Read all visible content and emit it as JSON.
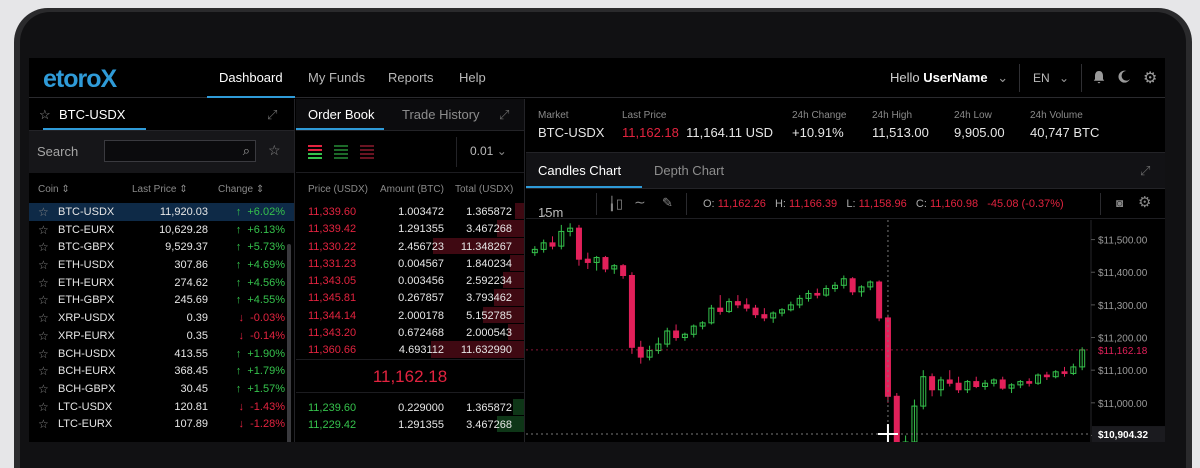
{
  "brand": {
    "name": "etoro",
    "mark": "X"
  },
  "nav": {
    "items": [
      "Dashboard",
      "My Funds",
      "Reports",
      "Help"
    ],
    "active": "Dashboard",
    "hello": "Hello",
    "username": "UserName",
    "language": "EN"
  },
  "market": {
    "tab_label": "BTC-USDX",
    "search_label": "Search",
    "search_value": "",
    "columns": {
      "coin": "Coin",
      "last_price": "Last Price",
      "change": "Change"
    },
    "rows": [
      {
        "coin": "BTC-USDX",
        "price": "11,920.03",
        "change": "+6.02%",
        "dir": "up",
        "selected": true
      },
      {
        "coin": "BTC-EURX",
        "price": "10,629.28",
        "change": "+6.13%",
        "dir": "up"
      },
      {
        "coin": "BTC-GBPX",
        "price": "9,529.37",
        "change": "+5.73%",
        "dir": "up"
      },
      {
        "coin": "ETH-USDX",
        "price": "307.86",
        "change": "+4.69%",
        "dir": "up"
      },
      {
        "coin": "ETH-EURX",
        "price": "274.62",
        "change": "+4.56%",
        "dir": "up"
      },
      {
        "coin": "ETH-GBPX",
        "price": "245.69",
        "change": "+4.55%",
        "dir": "up"
      },
      {
        "coin": "XRP-USDX",
        "price": "0.39",
        "change": "-0.03%",
        "dir": "down"
      },
      {
        "coin": "XRP-EURX",
        "price": "0.35",
        "change": "-0.14%",
        "dir": "down"
      },
      {
        "coin": "BCH-USDX",
        "price": "413.55",
        "change": "+1.90%",
        "dir": "up"
      },
      {
        "coin": "BCH-EURX",
        "price": "368.45",
        "change": "+1.79%",
        "dir": "up"
      },
      {
        "coin": "BCH-GBPX",
        "price": "30.45",
        "change": "+1.57%",
        "dir": "up"
      },
      {
        "coin": "LTC-USDX",
        "price": "120.81",
        "change": "-1.43%",
        "dir": "down"
      },
      {
        "coin": "LTC-EURX",
        "price": "107.89",
        "change": "-1.28%",
        "dir": "down"
      }
    ]
  },
  "orderbook": {
    "tabs": [
      "Order Book",
      "Trade History"
    ],
    "precision": "0.01",
    "columns": {
      "price": "Price (USDX)",
      "amount": "Amount (BTC)",
      "total": "Total (USDX)"
    },
    "asks": [
      {
        "price": "11,339.60",
        "amount": "1.003472",
        "total": "1.365872",
        "depth": 0.04
      },
      {
        "price": "11,339.42",
        "amount": "1.291355",
        "total": "3.467268",
        "depth": 0.12
      },
      {
        "price": "11,330.22",
        "amount": "2.456723",
        "total": "11.348267",
        "depth": 0.4
      },
      {
        "price": "11,331.23",
        "amount": "0.004567",
        "total": "1.840234",
        "depth": 0.06
      },
      {
        "price": "11,343.05",
        "amount": "0.003456",
        "total": "2.592234",
        "depth": 0.09
      },
      {
        "price": "11,345.81",
        "amount": "0.267857",
        "total": "3.793462",
        "depth": 0.13
      },
      {
        "price": "11,344.14",
        "amount": "2.000178",
        "total": "5.152785",
        "depth": 0.18
      },
      {
        "price": "11,343.20",
        "amount": "0.672468",
        "total": "2.000543",
        "depth": 0.07
      },
      {
        "price": "11,360.66",
        "amount": "4.693112",
        "total": "11.632990",
        "depth": 0.41
      }
    ],
    "spread": "11,162.18",
    "bids": [
      {
        "price": "11,239.60",
        "amount": "0.229000",
        "total": "1.365872",
        "depth": 0.05
      },
      {
        "price": "11,229.42",
        "amount": "1.291355",
        "total": "3.467268",
        "depth": 0.12
      }
    ]
  },
  "ticker": {
    "market_label": "Market",
    "market": "BTC-USDX",
    "last_price_label": "Last Price",
    "last_price_a": "11,162.18",
    "last_price_b": "11,164.11 USD",
    "change_label": "24h Change",
    "change": "+10.91%",
    "high_label": "24h High",
    "high": "11,513.00",
    "low_label": "24h Low",
    "low": "9,905.00",
    "volume_label": "24h Volume",
    "volume": "40,747 BTC"
  },
  "chart": {
    "tabs": [
      "Candles Chart",
      "Depth Chart"
    ],
    "interval": "15m",
    "ohlc": {
      "o_label": "O:",
      "o": "11,162.26",
      "h_label": "H:",
      "h": "11,166.39",
      "l_label": "L:",
      "l": "11,158.96",
      "c_label": "C:",
      "c": "11,160.98",
      "change": "-45.08 (-0.37%)"
    }
  },
  "chart_data": {
    "type": "candlestick",
    "y_ticks": [
      "$11,500.00",
      "$11,400.00",
      "$11,300.00",
      "$11,200.00",
      "$11,100.00",
      "$11,000.00",
      "$10,900.00"
    ],
    "y_tick_values": [
      11500,
      11400,
      11300,
      11200,
      11100,
      11000,
      10900
    ],
    "ylim": [
      10880,
      11560
    ],
    "last_label": "$11,162.18",
    "last_value": 11162.18,
    "crosshair_label": "$10,904.32",
    "crosshair_value": 10904.32,
    "crosshair_index": 40,
    "colors": {
      "up": "#35c24c",
      "down": "#e2205a"
    },
    "candles": [
      [
        11460,
        11480,
        11450,
        11470
      ],
      [
        11470,
        11500,
        11460,
        11490
      ],
      [
        11490,
        11510,
        11470,
        11480
      ],
      [
        11480,
        11545,
        11470,
        11525
      ],
      [
        11525,
        11550,
        11510,
        11535
      ],
      [
        11535,
        11545,
        11420,
        11440
      ],
      [
        11440,
        11460,
        11410,
        11430
      ],
      [
        11430,
        11450,
        11405,
        11445
      ],
      [
        11445,
        11450,
        11400,
        11410
      ],
      [
        11410,
        11425,
        11395,
        11420
      ],
      [
        11420,
        11425,
        11380,
        11390
      ],
      [
        11390,
        11400,
        11150,
        11170
      ],
      [
        11170,
        11190,
        11120,
        11140
      ],
      [
        11140,
        11175,
        11130,
        11160
      ],
      [
        11160,
        11200,
        11150,
        11180
      ],
      [
        11180,
        11230,
        11170,
        11220
      ],
      [
        11220,
        11240,
        11190,
        11200
      ],
      [
        11200,
        11215,
        11190,
        11210
      ],
      [
        11210,
        11240,
        11200,
        11235
      ],
      [
        11235,
        11250,
        11225,
        11245
      ],
      [
        11245,
        11300,
        11240,
        11290
      ],
      [
        11290,
        11330,
        11270,
        11280
      ],
      [
        11280,
        11320,
        11275,
        11310
      ],
      [
        11310,
        11330,
        11290,
        11300
      ],
      [
        11300,
        11320,
        11280,
        11290
      ],
      [
        11290,
        11300,
        11260,
        11270
      ],
      [
        11270,
        11290,
        11250,
        11260
      ],
      [
        11260,
        11280,
        11245,
        11275
      ],
      [
        11275,
        11290,
        11265,
        11285
      ],
      [
        11285,
        11310,
        11280,
        11300
      ],
      [
        11300,
        11330,
        11290,
        11320
      ],
      [
        11320,
        11345,
        11310,
        11335
      ],
      [
        11335,
        11350,
        11320,
        11330
      ],
      [
        11330,
        11360,
        11325,
        11350
      ],
      [
        11350,
        11370,
        11340,
        11360
      ],
      [
        11360,
        11390,
        11350,
        11380
      ],
      [
        11380,
        11385,
        11330,
        11340
      ],
      [
        11340,
        11360,
        11325,
        11355
      ],
      [
        11355,
        11375,
        11345,
        11370
      ],
      [
        11370,
        11375,
        11250,
        11260
      ],
      [
        11260,
        11270,
        11000,
        11020
      ],
      [
        11020,
        11030,
        10700,
        10750
      ],
      [
        10750,
        10900,
        10700,
        10880
      ],
      [
        10880,
        11010,
        10860,
        10990
      ],
      [
        10990,
        11100,
        10980,
        11080
      ],
      [
        11080,
        11090,
        11020,
        11040
      ],
      [
        11040,
        11080,
        11020,
        11070
      ],
      [
        11070,
        11100,
        11050,
        11060
      ],
      [
        11060,
        11080,
        11030,
        11040
      ],
      [
        11040,
        11070,
        11030,
        11065
      ],
      [
        11065,
        11080,
        11045,
        11050
      ],
      [
        11050,
        11070,
        11040,
        11060
      ],
      [
        11060,
        11075,
        11050,
        11070
      ],
      [
        11070,
        11080,
        11040,
        11045
      ],
      [
        11045,
        11060,
        11030,
        11055
      ],
      [
        11055,
        11070,
        11045,
        11065
      ],
      [
        11065,
        11075,
        11050,
        11060
      ],
      [
        11060,
        11090,
        11055,
        11085
      ],
      [
        11085,
        11095,
        11070,
        11080
      ],
      [
        11080,
        11100,
        11075,
        11095
      ],
      [
        11095,
        11110,
        11080,
        11090
      ],
      [
        11090,
        11120,
        11085,
        11110
      ],
      [
        11110,
        11170,
        11100,
        11162
      ]
    ]
  }
}
